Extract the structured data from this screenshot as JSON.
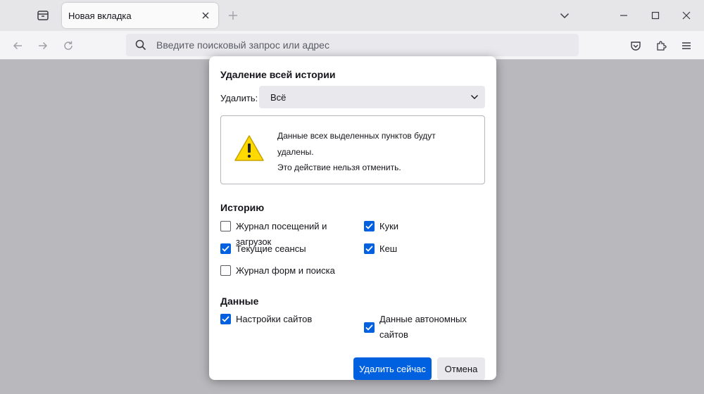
{
  "browser": {
    "tab_title": "Новая вкладка",
    "url_placeholder": "Введите поисковый запрос или адрес"
  },
  "dialog": {
    "title": "Удаление всей истории",
    "range_label": "Удалить:",
    "range_value": "Всё",
    "warning": {
      "line1": "Данные всех выделенных пунктов будут",
      "line2": "удалены.",
      "line3": "Это действие нельзя отменить."
    },
    "history_heading": "Историю",
    "history_items": [
      {
        "label": "Журнал посещений и загрузок",
        "checked": false
      },
      {
        "label": "Куки",
        "checked": true
      },
      {
        "label": "Текущие сеансы",
        "checked": true
      },
      {
        "label": "Кеш",
        "checked": true
      },
      {
        "label": "Журнал форм и поиска",
        "checked": false
      }
    ],
    "data_heading": "Данные",
    "data_items": [
      {
        "label": "Настройки сайтов",
        "checked": true
      },
      {
        "label": "Данные автономных сайтов",
        "checked": true
      }
    ],
    "confirm_button": "Удалить сейчас",
    "cancel_button": "Отмена"
  },
  "colors": {
    "accent": "#0061e0",
    "warning_yellow": "#ffd900",
    "chrome_bg": "#e6e6e8",
    "content_bg": "#b8b8bd"
  },
  "icons": [
    "tab-list-icon",
    "close-icon",
    "plus-icon",
    "chevron-down-icon",
    "minimize-icon",
    "maximize-icon",
    "back-arrow-icon",
    "forward-arrow-icon",
    "reload-icon",
    "search-icon",
    "pocket-icon",
    "extensions-icon",
    "menu-icon",
    "warning-icon",
    "checkmark-icon"
  ]
}
